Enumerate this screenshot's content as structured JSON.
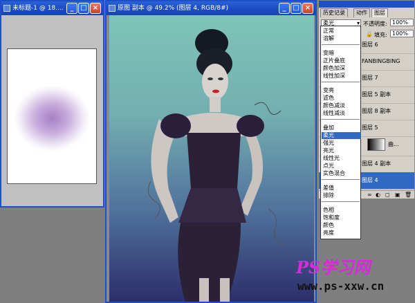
{
  "left_window": {
    "title": "未标题-1 @ 18...."
  },
  "main_window": {
    "title": "原图 副本 @ 49.2% (图层 4, RGB/8#)"
  },
  "panel": {
    "tabs": [
      "历史记录",
      "动作",
      "图层"
    ],
    "blend_mode": "柔光",
    "opacity_label": "不透明度:",
    "opacity_value": "100%",
    "lock_label": "锁",
    "fill_label": "填充:",
    "fill_value": "100%",
    "layers": [
      "图层 6",
      "FANBINGBING",
      "图层 7",
      "图层 5 副本",
      "图层 8 副本",
      "图层 5",
      "曲...",
      "图层 4 副本",
      "图层 4"
    ]
  },
  "blend_menu": {
    "groups": [
      [
        "正常",
        "溶解"
      ],
      [
        "变暗",
        "正片叠底",
        "颜色加深",
        "线性加深"
      ],
      [
        "变亮",
        "滤色",
        "颜色减淡",
        "线性减淡"
      ],
      [
        "叠加",
        "柔光",
        "强光",
        "亮光",
        "线性光",
        "点光",
        "实色混合"
      ],
      [
        "差值",
        "排除"
      ],
      [
        "色相",
        "饱和度",
        "颜色",
        "亮度"
      ]
    ],
    "selected": "柔光"
  },
  "watermark": {
    "brand": "PS学习网",
    "url": "www.ps-xxw.cn"
  },
  "colors": {
    "accent": "#316ac5",
    "brand": "#d22dd9",
    "titlebar": "#1f4fc6"
  }
}
